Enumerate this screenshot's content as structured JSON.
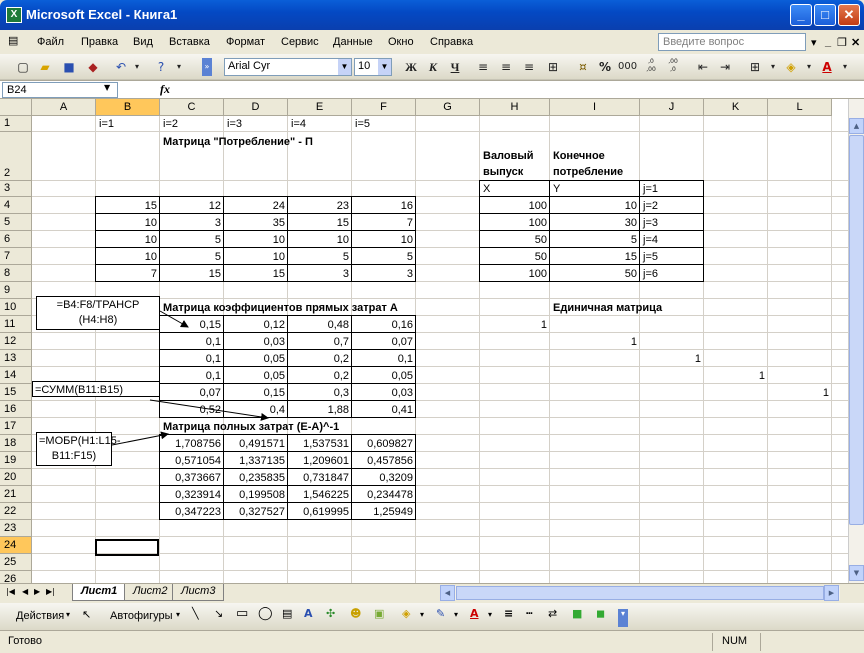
{
  "window": {
    "title": "Microsoft Excel - Книга1"
  },
  "menu": [
    "Файл",
    "Правка",
    "Вид",
    "Вставка",
    "Формат",
    "Сервис",
    "Данные",
    "Окно",
    "Справка"
  ],
  "help_placeholder": "Введите вопрос",
  "toolbar": {
    "font": "Arial Cyr",
    "size": "10",
    "bold": "Ж",
    "italic": "К",
    "underline": "Ч",
    "percent": "%",
    "thousands": "000",
    "inc_dec": ",0\n,00",
    "dec_dec": ",00\n,0"
  },
  "formula_bar": {
    "name_box": "B24",
    "fx": "fx",
    "content": ""
  },
  "columns": [
    "A",
    "B",
    "C",
    "D",
    "E",
    "F",
    "G",
    "H",
    "I",
    "J",
    "K",
    "L"
  ],
  "rows": [
    "1",
    "2",
    "3",
    "4",
    "5",
    "6",
    "7",
    "8",
    "9",
    "10",
    "11",
    "12",
    "13",
    "14",
    "15",
    "16",
    "17",
    "18",
    "19",
    "20",
    "21",
    "22",
    "23",
    "24",
    "25",
    "26"
  ],
  "cells": {
    "row1": [
      "i=1",
      "i=2",
      "i=3",
      "i=4",
      "i=5"
    ],
    "title_consumption": "Матрица \"Потребление\" - П",
    "header_gross": [
      "Валовый",
      "выпуск"
    ],
    "header_final": [
      "Конечное",
      "потребление"
    ],
    "x_label": "X",
    "y_label": "Y",
    "j_labels": [
      "j=1",
      "j=2",
      "j=3",
      "j=4",
      "j=5",
      "j=6"
    ],
    "consumption": [
      [
        "15",
        "12",
        "24",
        "23",
        "16"
      ],
      [
        "10",
        "3",
        "35",
        "15",
        "7"
      ],
      [
        "10",
        "5",
        "10",
        "10",
        "10"
      ],
      [
        "10",
        "5",
        "10",
        "5",
        "5"
      ],
      [
        "7",
        "15",
        "15",
        "3",
        "3"
      ]
    ],
    "gross": [
      "100",
      "100",
      "50",
      "50",
      "100"
    ],
    "final": [
      "10",
      "30",
      "5",
      "15",
      "50"
    ],
    "title_direct": "Матрица коэффициентов прямых затрат А",
    "title_identity": "Единичная матрица",
    "direct": [
      [
        "0,15",
        "0,12",
        "0,48",
        "0,16"
      ],
      [
        "0,1",
        "0,03",
        "0,7",
        "0,07"
      ],
      [
        "0,1",
        "0,05",
        "0,2",
        "0,1"
      ],
      [
        "0,1",
        "0,05",
        "0,2",
        "0,05"
      ],
      [
        "0,07",
        "0,15",
        "0,3",
        "0,03"
      ],
      [
        "0,52",
        "0,4",
        "1,88",
        "0,41"
      ]
    ],
    "identity_ones": [
      "1",
      "1",
      "1",
      "1",
      "1"
    ],
    "title_full": "Матрица полных затрат (Е-А)^-1",
    "full": [
      [
        "1,708756",
        "0,491571",
        "1,537531",
        "0,609827"
      ],
      [
        "0,571054",
        "1,337135",
        "1,209601",
        "0,457856"
      ],
      [
        "0,373667",
        "0,235835",
        "0,731847",
        "0,3209"
      ],
      [
        "0,323914",
        "0,199508",
        "1,546225",
        "0,234478"
      ],
      [
        "0,347223",
        "0,327527",
        "0,619995",
        "1,25949"
      ]
    ]
  },
  "callouts": {
    "transp": "=B4:F8/ТРАНСР (H4:H8)",
    "sum": "=СУММ(B11:B15)",
    "inverse": "=МОБР(H1:L15-B11:F15)"
  },
  "sheets": [
    "Лист1",
    "Лист2",
    "Лист3"
  ],
  "drawing": {
    "actions": "Действия",
    "autoshapes": "Автофигуры"
  },
  "status": {
    "ready": "Готово",
    "num": "NUM"
  }
}
